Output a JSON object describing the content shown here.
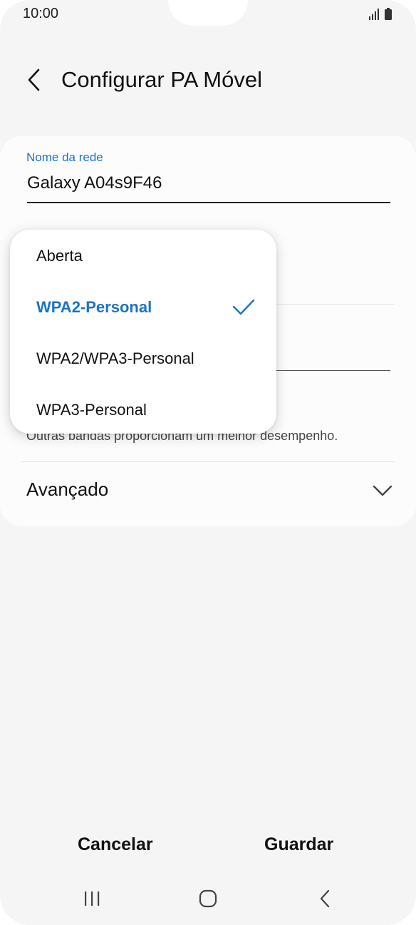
{
  "status_bar": {
    "time": "10:00"
  },
  "header": {
    "title": "Configurar PA Móvel",
    "back_icon": "chevron-left-icon"
  },
  "network_name": {
    "label": "Nome da rede",
    "value": "Galaxy A04s9F46"
  },
  "security_dropdown": {
    "options": [
      {
        "label": "Aberta",
        "selected": false
      },
      {
        "label": "WPA2-Personal",
        "selected": true
      },
      {
        "label": "WPA2/WPA3-Personal",
        "selected": false
      },
      {
        "label": "WPA3-Personal",
        "selected": false
      }
    ],
    "selected_color": "#1a73c8"
  },
  "band": {
    "description": "Outras bandas proporcionam um melhor desempenho."
  },
  "advanced": {
    "label": "Avançado",
    "icon": "chevron-down-icon"
  },
  "footer": {
    "cancel_label": "Cancelar",
    "save_label": "Guardar"
  },
  "navbar": {
    "recents_icon": "recents-icon",
    "home_icon": "home-icon",
    "back_icon": "back-icon"
  },
  "colors": {
    "accent": "#1a73c8",
    "background": "#f5f5f5",
    "card": "#fcfcfc"
  }
}
